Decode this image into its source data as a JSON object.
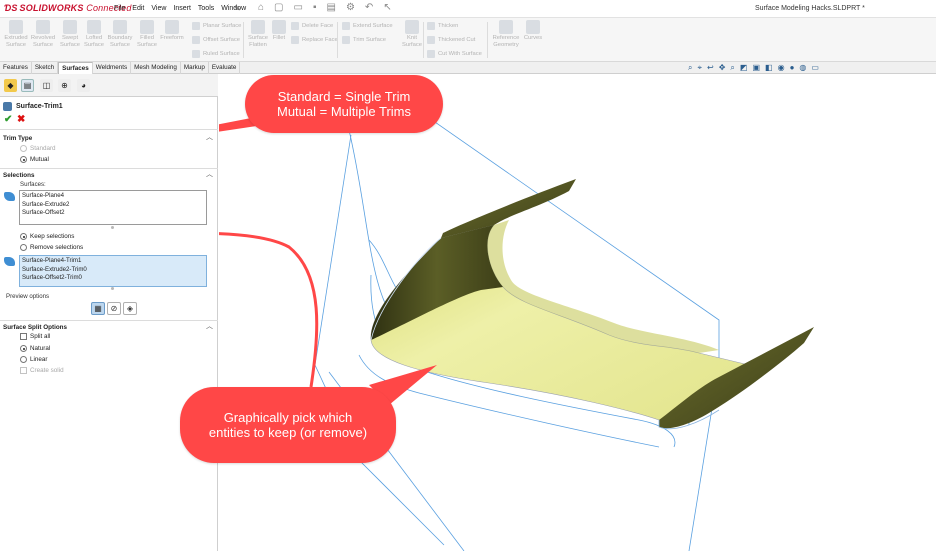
{
  "app": {
    "brand": "SOLIDWORKS",
    "brand_suffix": "Connected",
    "menus": [
      "File",
      "Edit",
      "View",
      "Insert",
      "Tools",
      "Window"
    ],
    "doc_title": "Surface Modeling Hacks.SLDPRT *"
  },
  "ribbon": {
    "big_buttons": [
      "Extruded Surface",
      "Revolved Surface",
      "Swept Surface",
      "Lofted Surface",
      "Boundary Surface",
      "Filled Surface",
      "Freeform"
    ],
    "col1": [
      "Planar Surface",
      "Offset Surface",
      "Ruled Surface"
    ],
    "big2": [
      "Surface Flatten",
      "Fillet"
    ],
    "col2": [
      "Delete Face",
      "Replace Face"
    ],
    "col3": [
      "Extend Surface",
      "Trim Surface"
    ],
    "big3": [
      "Knit Surface"
    ],
    "col4": [
      "Thicken",
      "Thickened Cut",
      "Cut With Surface"
    ],
    "big4": [
      "Reference Geometry",
      "Curves"
    ]
  },
  "tabs": [
    "Features",
    "Sketch",
    "Surfaces",
    "Weldments",
    "Mesh Modeling",
    "Markup",
    "Evaluate"
  ],
  "panel": {
    "feature_name": "Surface-Trim1",
    "trim_type": {
      "header": "Trim Type",
      "standard": "Standard",
      "mutual": "Mutual"
    },
    "selections": {
      "header": "Selections",
      "surfaces_label": "Surfaces:",
      "surfaces": [
        "Surface-Plane4",
        "Surface-Extrude2",
        "Surface-Offset2"
      ],
      "keep": "Keep selections",
      "remove": "Remove selections",
      "pieces": [
        "Surface-Plane4-Trim1",
        "Surface-Extrude2-Trim0",
        "Surface-Offset2-Trim0"
      ],
      "preview_label": "Preview options"
    },
    "split": {
      "header": "Surface Split Options",
      "split_all": "Split all",
      "natural": "Natural",
      "linear": "Linear",
      "create_solid": "Create solid"
    }
  },
  "callouts": {
    "top": [
      "Standard = Single Trim",
      "Mutual = Multiple Trims"
    ],
    "bottom": [
      "Graphically pick which",
      "entities to keep (or remove)"
    ],
    "color": "#ff4747"
  },
  "colors": {
    "surface_top": "#e7e894",
    "surface_dark": "#4d4f20",
    "edge_blue": "#4a90d9"
  }
}
